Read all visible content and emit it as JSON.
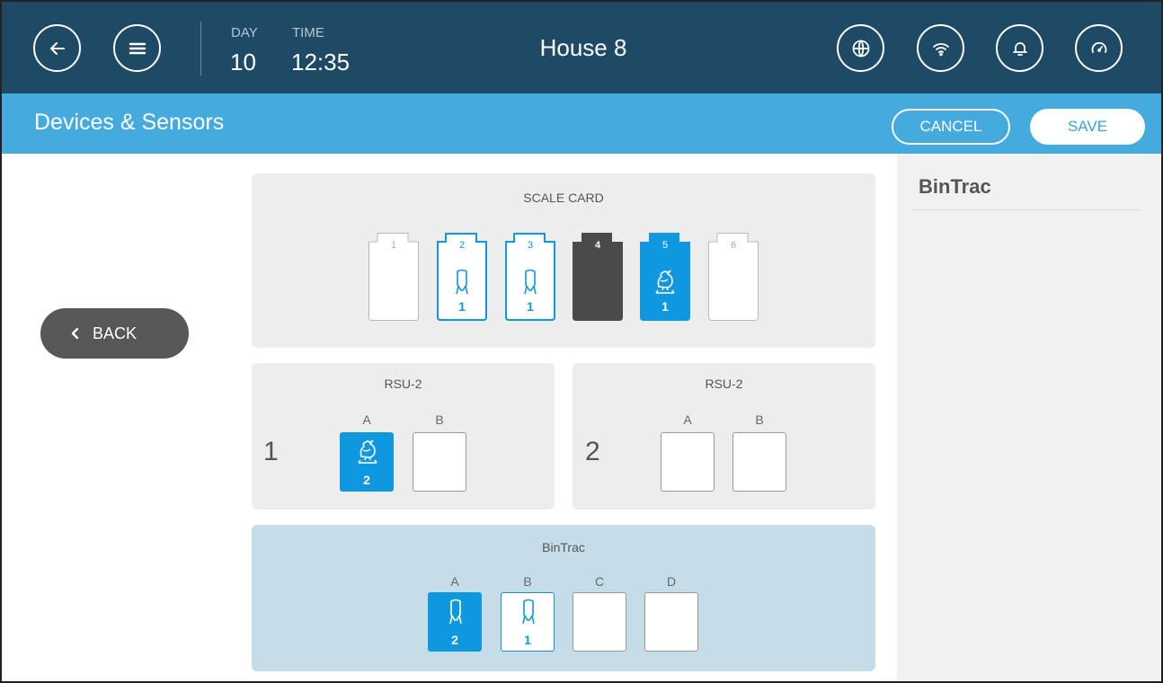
{
  "header": {
    "day_label": "DAY",
    "day_value": "10",
    "time_label": "TIME",
    "time_value": "12:35",
    "title": "House 8",
    "icons": [
      "back-arrow-icon",
      "menu-icon",
      "globe-icon",
      "wifi-icon",
      "bell-icon",
      "gauge-icon"
    ]
  },
  "subheader": {
    "title": "Devices & Sensors",
    "cancel_label": "CANCEL",
    "save_label": "SAVE"
  },
  "side": {
    "back_label": "BACK"
  },
  "scale_card": {
    "title": "SCALE CARD",
    "slots": [
      {
        "number": "1",
        "state": "empty",
        "count": ""
      },
      {
        "number": "2",
        "state": "bin-scale-outline",
        "count": "1"
      },
      {
        "number": "3",
        "state": "bin-scale-outline",
        "count": "1"
      },
      {
        "number": "4",
        "state": "dark",
        "count": ""
      },
      {
        "number": "5",
        "state": "bird-scale-filled",
        "count": "1"
      },
      {
        "number": "6",
        "state": "empty",
        "count": ""
      }
    ]
  },
  "rsu_left": {
    "title": "RSU-2",
    "index": "1",
    "ports": [
      {
        "label": "A",
        "state": "bird-scale-filled",
        "count": "2"
      },
      {
        "label": "B",
        "state": "empty",
        "count": ""
      }
    ]
  },
  "rsu_right": {
    "title": "RSU-2",
    "index": "2",
    "ports": [
      {
        "label": "A",
        "state": "empty",
        "count": ""
      },
      {
        "label": "B",
        "state": "empty",
        "count": ""
      }
    ]
  },
  "bintrac_card": {
    "title": "BinTrac",
    "ports": [
      {
        "label": "A",
        "state": "bin-scale-filled",
        "count": "2"
      },
      {
        "label": "B",
        "state": "bin-scale-outline",
        "count": "1"
      },
      {
        "label": "C",
        "state": "empty",
        "count": ""
      },
      {
        "label": "D",
        "state": "empty",
        "count": ""
      }
    ]
  },
  "right_panel": {
    "title": "BinTrac"
  },
  "colors": {
    "header_bg": "#1f4a66",
    "subheader_bg": "#45aadd",
    "accent_blue": "#0f97e0",
    "card_bg": "#ededed",
    "selected_card_bg": "#c4dde9",
    "dark_slot": "#4a4a4a"
  }
}
